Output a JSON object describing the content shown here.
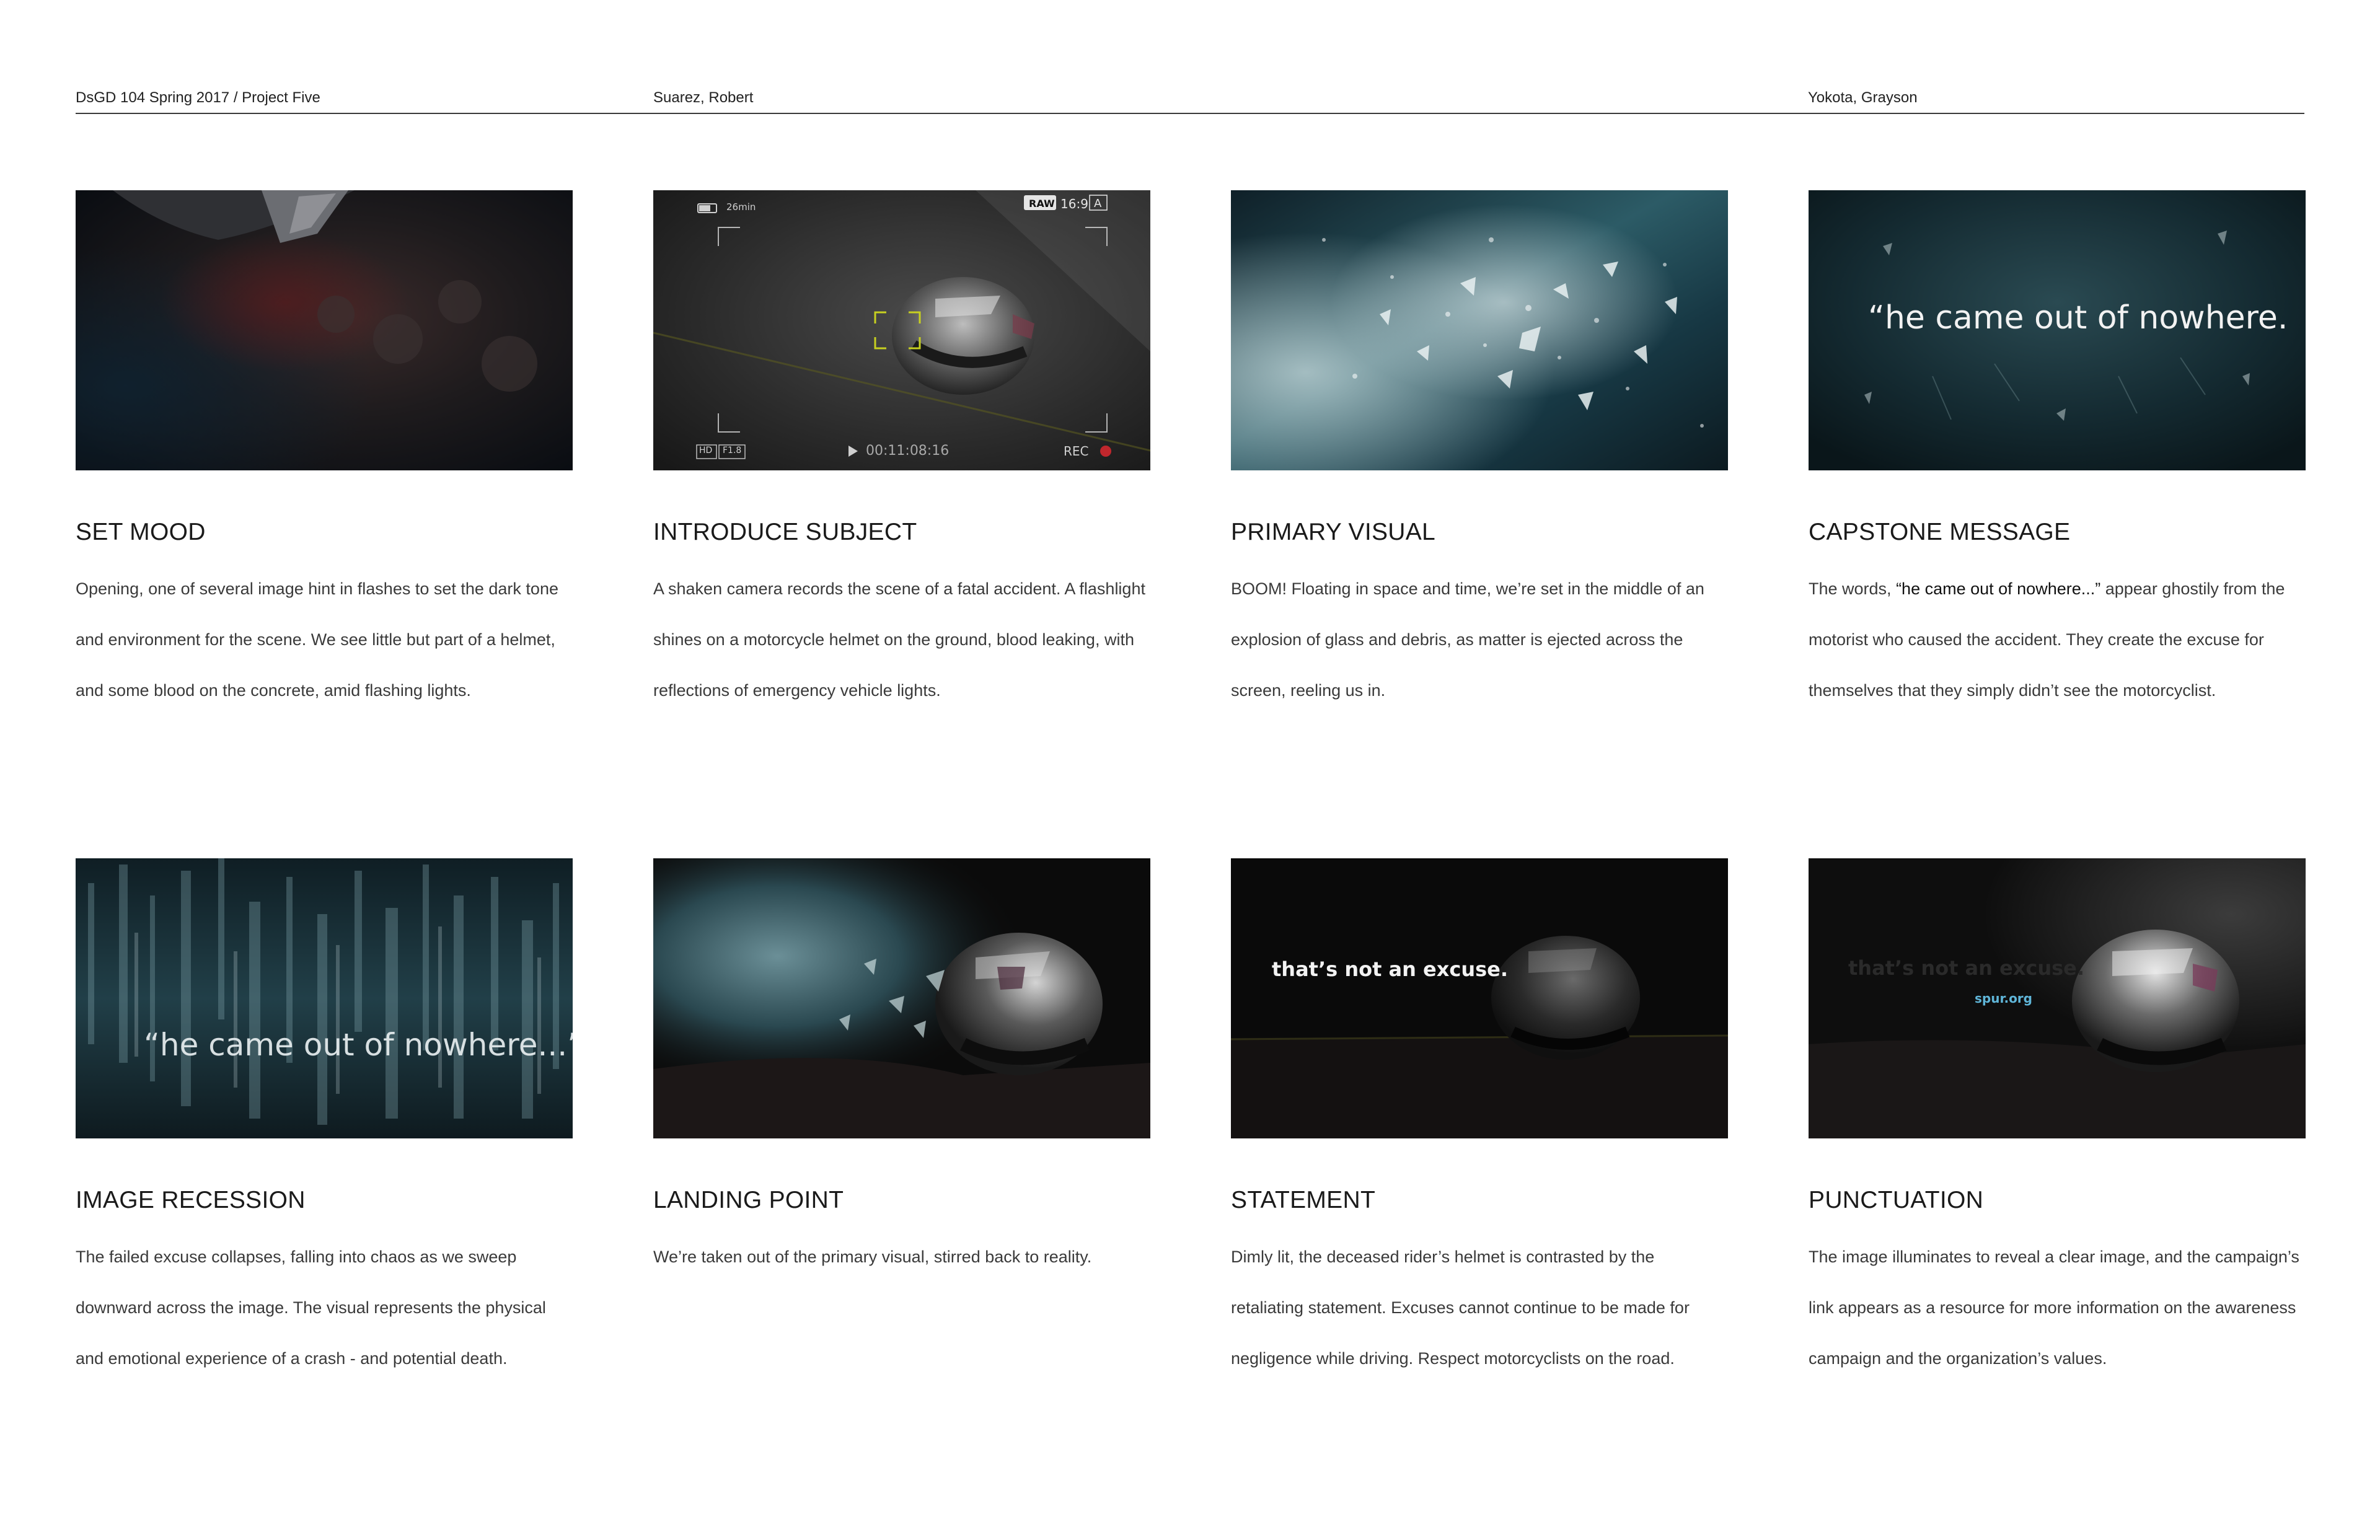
{
  "header": {
    "course": "DsGD 104  Spring 2017  /  Project Five",
    "author_one": "Suarez, Robert",
    "author_two": "Yokota, Grayson"
  },
  "frames": [
    {
      "title": "SET MOOD",
      "description": "Opening, one of several image hint in flashes to set the dark tone and environment for the scene. We see little but part of a helmet, and some blood on the concrete, amid flashing lights."
    },
    {
      "title": "INTRODUCE SUBJECT",
      "description": "A shaken camera records the scene of a fatal accident. A flashlight shines on a motorcycle helmet on the ground, blood leaking, with reflections of emergency vehicle lights.",
      "camera_ui": {
        "battery": "26min",
        "raw": "RAW",
        "ratio": "16:9",
        "auto": "A",
        "hd": "HD",
        "fstop": "F1.8",
        "timecode": "00:11:08:16",
        "rec": "REC"
      }
    },
    {
      "title": "PRIMARY VISUAL",
      "description": "BOOM! Floating in space and time, we’re set in the middle of an explosion of glass and debris, as matter is ejected across the screen, reeling us in."
    },
    {
      "title": "CAPSTONE MESSAGE",
      "description_before": "The words, ",
      "description_quote": "“he came out of nowhere...”",
      "description_after": " appear ghostily from the motorist who caused the accident. They create the excuse for themselves that they simply didn’t see the motorcyclist.",
      "overlay_text": "“he came out of nowhere."
    },
    {
      "title": "IMAGE RECESSION",
      "description": "The failed excuse collapses, falling into chaos as we sweep downward across the image. The visual represents the physical and emotional experience of a crash - and potential death.",
      "overlay_text": "“he came out of nowhere...”"
    },
    {
      "title": "LANDING POINT",
      "description": "We’re taken out of the primary visual, stirred back to reality."
    },
    {
      "title": "STATEMENT",
      "description": "Dimly lit, the deceased rider’s helmet is contrasted by the retaliating statement. Excuses cannot continue to be made for negligence while driving. Respect motorcyclists on the road.",
      "overlay_text": "that’s not an excuse."
    },
    {
      "title": "PUNCTUATION",
      "description": "The image illuminates to reveal a clear image, and the campaign’s link appears as a resource for more information on the awareness campaign and the organization’s values.",
      "overlay_text": "that’s not an excuse.",
      "overlay_link": "spur.org"
    }
  ]
}
